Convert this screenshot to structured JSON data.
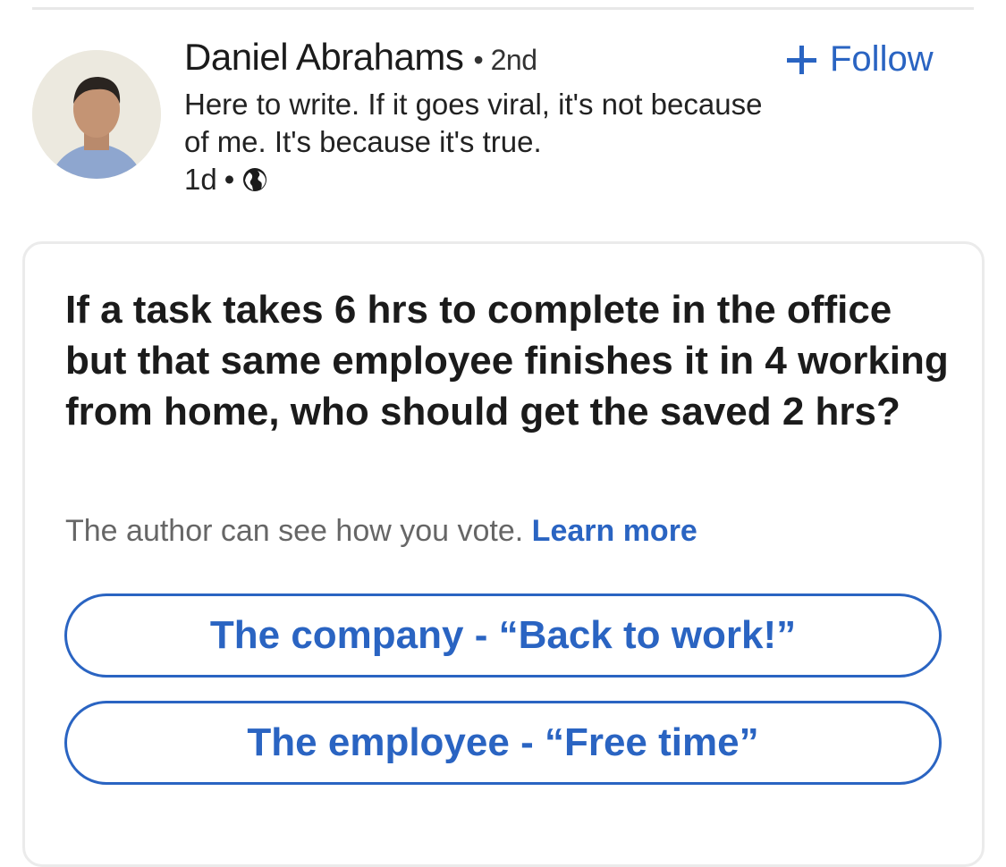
{
  "author": {
    "name": "Daniel Abrahams",
    "degree": "• 2nd",
    "headline": "Here to write. If it goes viral, it's not because of me. It's because it's true.",
    "time": "1d",
    "visibility_icon": "globe-icon",
    "follow_label": "Follow"
  },
  "poll": {
    "question": "If a task takes 6 hrs to complete in the office but that same employee finishes it in 4 working from home, who should get the saved 2 hrs?",
    "note": "The author can see how you vote.",
    "learn_more": "Learn more",
    "options": [
      {
        "label": "The company - “Back to work!”"
      },
      {
        "label": "The employee - “Free time”"
      }
    ]
  },
  "colors": {
    "accent": "#2a64c2",
    "text": "#1b1b1b",
    "muted": "#666666"
  }
}
